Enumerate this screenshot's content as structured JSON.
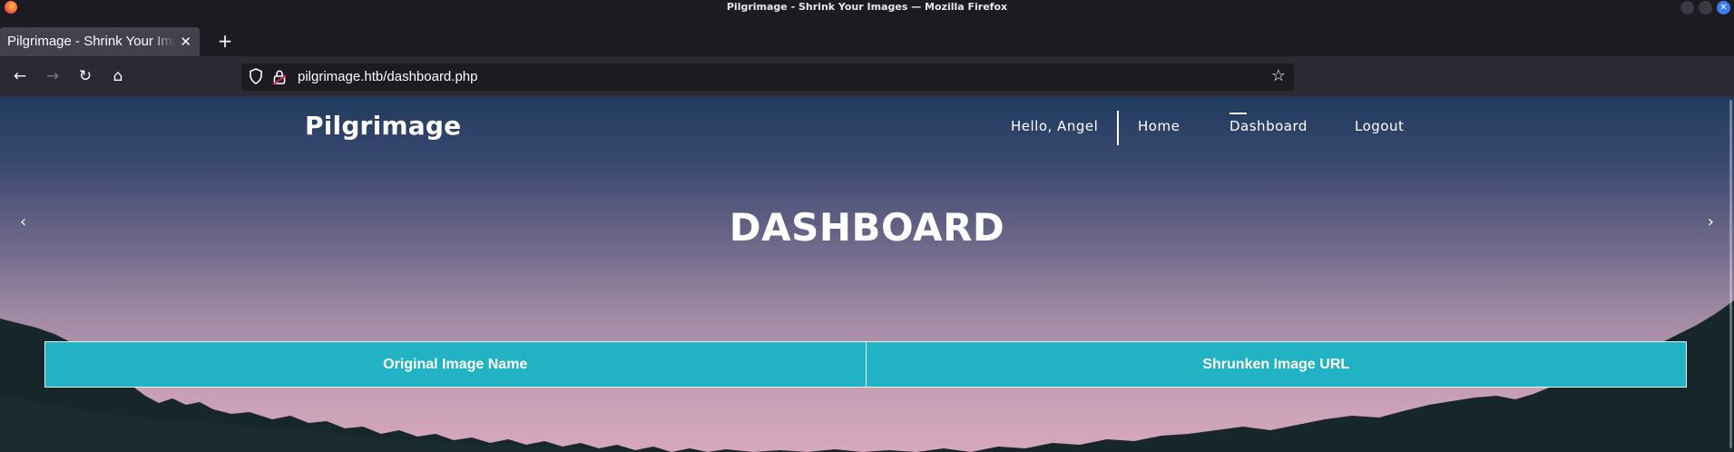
{
  "window": {
    "title": "Pilgrimage - Shrink Your Images — Mozilla Firefox",
    "close_glyph": "✕"
  },
  "tabs": [
    {
      "label": "Pilgrimage - Shrink Your Images",
      "active": true,
      "close_glyph": "✕"
    }
  ],
  "new_tab_glyph": "+",
  "toolbar": {
    "back_glyph": "←",
    "forward_glyph": "→",
    "reload_glyph": "↻",
    "home_glyph": "⌂",
    "url": "pilgrimage.htb/dashboard.php",
    "bookmark_glyph": "☆"
  },
  "site": {
    "brand": "Pilgrimage",
    "nav": {
      "greeting": "Hello, Angel",
      "home": "Home",
      "dashboard": "Dashboard",
      "logout": "Logout",
      "active": "Dashboard"
    },
    "heading": "DASHBOARD",
    "carousel": {
      "prev_glyph": "‹",
      "next_glyph": "›"
    },
    "table": {
      "headers": [
        "Original Image Name",
        "Shrunken Image URL"
      ],
      "rows": []
    }
  },
  "colors": {
    "table_header_bg": "#21b2c3",
    "browser_chrome": "#1c1b22",
    "toolbar_bg": "#2b2a33",
    "tab_active_bg": "#42414d",
    "mountain_fill": "#16262a"
  },
  "icons": [
    "firefox-logo-icon",
    "shield-icon",
    "lock-icon",
    "star-icon"
  ]
}
